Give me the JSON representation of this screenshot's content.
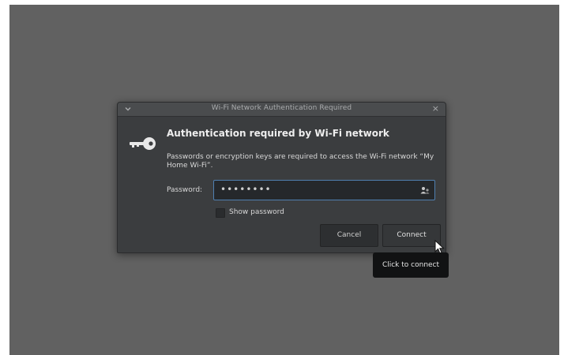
{
  "dialog": {
    "title": "Wi-Fi Network Authentication Required",
    "menu_icon": "chevron-down-icon",
    "close_glyph": "×",
    "key_icon": "key-icon",
    "heading": "Authentication required by Wi-Fi network",
    "message": "Passwords or encryption keys are required to access the Wi-Fi network “My Home Wi-Fi”.",
    "password_label": "Password:",
    "password_value": "••••••••",
    "password_user_icon": "user-icon",
    "show_password_label": "Show password",
    "show_password_checked": false,
    "cancel_label": "Cancel",
    "connect_label": "Connect"
  },
  "tooltip": {
    "text": "Click to connect"
  },
  "colors": {
    "desktop": "#616161",
    "dialog_bg": "#3b3d3f",
    "input_focus": "#4f7fb0",
    "tooltip_bg": "#111213"
  }
}
